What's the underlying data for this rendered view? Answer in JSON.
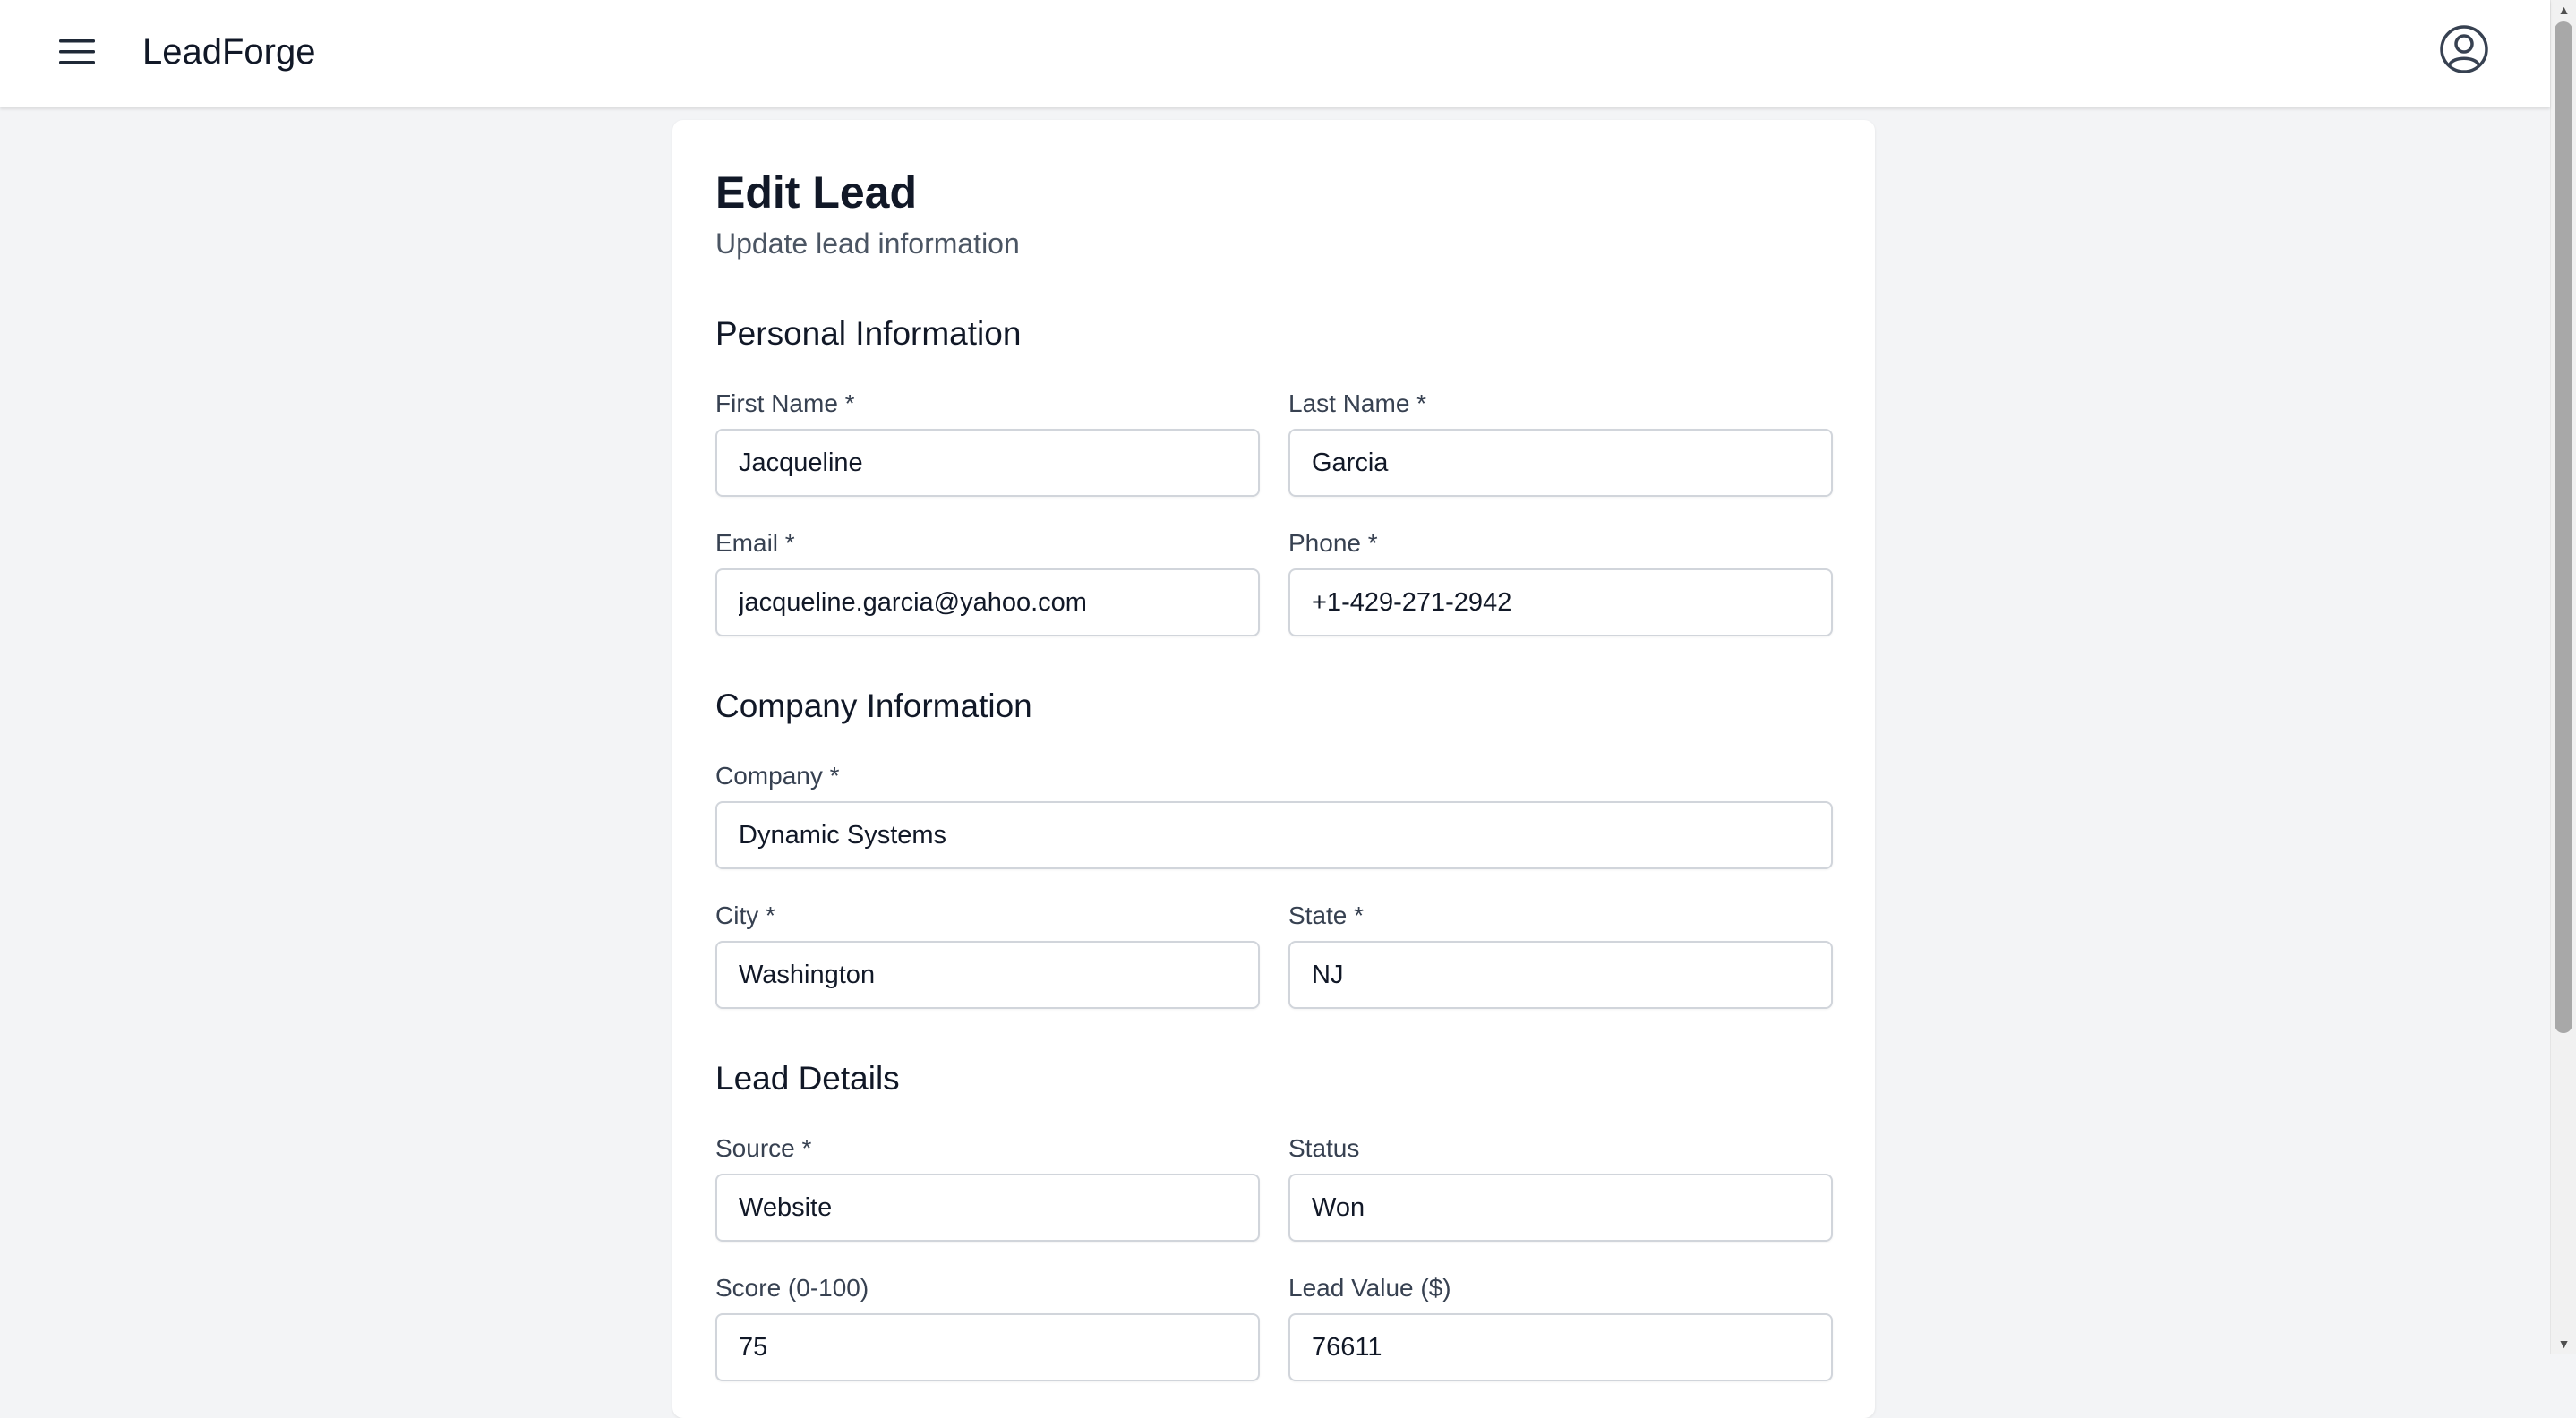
{
  "app": {
    "name": "LeadForge",
    "menu_icon": "hamburger-menu-icon",
    "account_icon": "user-circle-icon"
  },
  "page": {
    "title": "Edit Lead",
    "subtitle": "Update lead information"
  },
  "sections": {
    "personal": {
      "title": "Personal Information",
      "first_name": {
        "label": "First Name *",
        "value": "Jacqueline"
      },
      "last_name": {
        "label": "Last Name *",
        "value": "Garcia"
      },
      "email": {
        "label": "Email *",
        "value": "jacqueline.garcia@yahoo.com"
      },
      "phone": {
        "label": "Phone *",
        "value": "+1-429-271-2942"
      }
    },
    "company": {
      "title": "Company Information",
      "company": {
        "label": "Company *",
        "value": "Dynamic Systems"
      },
      "city": {
        "label": "City *",
        "value": "Washington"
      },
      "state": {
        "label": "State *",
        "value": "NJ"
      }
    },
    "lead": {
      "title": "Lead Details",
      "source": {
        "label": "Source *",
        "value": "Website"
      },
      "status": {
        "label": "Status",
        "value": "Won"
      },
      "score": {
        "label": "Score (0-100)",
        "value": "75"
      },
      "lead_value": {
        "label": "Lead Value ($)",
        "value": "76611"
      }
    }
  },
  "colors": {
    "background": "#f3f4f6",
    "card": "#ffffff",
    "text_primary": "#111827",
    "text_secondary": "#4b5563",
    "input_border": "#d1d5db"
  }
}
